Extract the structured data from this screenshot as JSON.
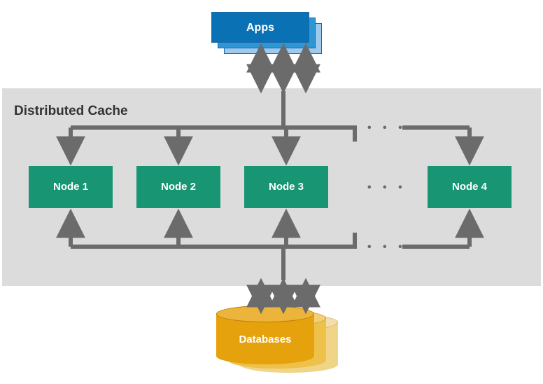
{
  "apps": {
    "label": "Apps"
  },
  "cache": {
    "title": "Distributed Cache",
    "nodes": [
      "Node 1",
      "Node 2",
      "Node 3",
      "Node 4"
    ],
    "ellipsis": "• • •"
  },
  "databases": {
    "label": "Databases"
  },
  "colors": {
    "node": "#189674",
    "apps": "#0a71b4",
    "db": "#e6a20c",
    "arrow": "#6b6b6b",
    "panel": "#dcdcdc"
  }
}
